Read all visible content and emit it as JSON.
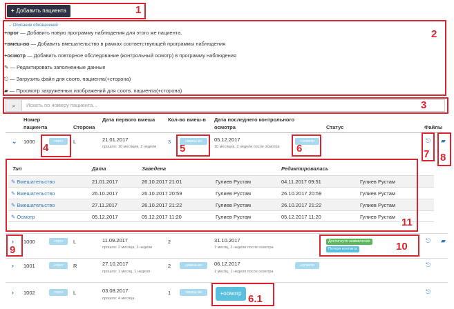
{
  "toolbar": {
    "add_patient_label": "Добавить пациента"
  },
  "legend": {
    "toggle_label": "Описание обозначений",
    "items": [
      {
        "prefix": "+прог",
        "text": " — Добавить новую программу наблюдения для этого же пациента."
      },
      {
        "prefix": "+вмеш-во",
        "text": " — Добавить вмешательство в рамках соответствующей программы наблюдения"
      },
      {
        "prefix": "+осмотр",
        "text": " — Добавить повторное обследование (контрольный осмотр) в программу наблюдения"
      },
      {
        "prefix": "",
        "text": " — Редактировать заполненные данные"
      },
      {
        "prefix": "",
        "text": " — Загрузить файл для соотв. пациента(+сторона)"
      },
      {
        "prefix": "",
        "text": " — Просмотр загруженных изображений для соотв. пациента(+сторона)"
      }
    ]
  },
  "search": {
    "placeholder": "Искать по номеру пациента..."
  },
  "table": {
    "headers": {
      "patient_number": "Номер пациента",
      "side": "Сторона",
      "first_intervention_date": "Дата первого вмеша",
      "intervention_count": "Кол-во вмеш-в",
      "last_checkup_date": "Дата последнего контрольного осмотра",
      "status": "Статус",
      "files": "Файлы"
    },
    "btn_prog": "+прог",
    "btn_interv": "+вмеш-во",
    "btn_checkup": "+осмотр",
    "rows": [
      {
        "number": "1000",
        "side": "L",
        "first_date": "21.01.2017",
        "first_ago": "прошло: 10 месяцев, 2 недели",
        "count": "3",
        "last_date": "05.12.2017",
        "last_ago": "10 месяцев, 2 недели после осмотра"
      },
      {
        "number": "1000",
        "side": "L",
        "first_date": "11.09.2017",
        "first_ago": "прошло: 2 месяца, 3 недели",
        "count": "2",
        "last_date": "31.10.2017",
        "last_ago": "1 месяц, 2 недели после осмотра",
        "badges": [
          "Достигнуто заживление",
          "Потеря контакта"
        ]
      },
      {
        "number": "1001",
        "side": "R",
        "first_date": "27.10.2017",
        "first_ago": "прошло: 1 месяц, 1 неделя",
        "count": "2",
        "last_date": "06.12.2017",
        "last_ago": "1 месяц, 1 неделя после осмотра"
      },
      {
        "number": "1002",
        "side": "L",
        "first_date": "03.08.2017",
        "first_ago": "прошло: 4 месяца",
        "count": "1",
        "last_date": "",
        "last_ago": ""
      }
    ],
    "big_checkup_label": "+осмотр"
  },
  "inner": {
    "headers": {
      "type": "Тип",
      "date": "Дата",
      "created": "Заведена",
      "edited": "Редактировалась"
    },
    "rows": [
      {
        "type": "Вмешательство",
        "date": "21.01.2017",
        "created_at": "26.10.2017 21:01",
        "created_by": "Гулиев Рустам",
        "edited_at": "04.11.2017 09:51",
        "edited_by": "Гулиев Рустам"
      },
      {
        "type": "Вмешательство",
        "date": "26.10.2017",
        "created_at": "26.10.2017 20:59",
        "created_by": "Гулиев Рустам",
        "edited_at": "26.10.2017 20:59",
        "edited_by": "Гулиев Рустам"
      },
      {
        "type": "Вмешательство",
        "date": "27.11.2017",
        "created_at": "26.10.2017 21:22",
        "created_by": "Гулиев Рустам",
        "edited_at": "26.10.2017 21:22",
        "edited_by": "Гулиев Рустам"
      },
      {
        "type": "Осмотр",
        "date": "05.12.2017",
        "created_at": "05.12.2017 11:20",
        "created_by": "Гулиев Рустам",
        "edited_at": "05.12.2017 11:20",
        "edited_by": "Гулиев Рустам"
      }
    ]
  },
  "annotations": [
    "1",
    "2",
    "3",
    "4",
    "5",
    "6",
    "6.1",
    "7",
    "8",
    "9",
    "10",
    "11"
  ],
  "colors": {
    "annotation": "#d9232e",
    "primary": "#337ab7",
    "dark_button": "#2d3142",
    "light_button": "#a9d9ee",
    "success": "#5cb85c",
    "info": "#5bc0de"
  }
}
